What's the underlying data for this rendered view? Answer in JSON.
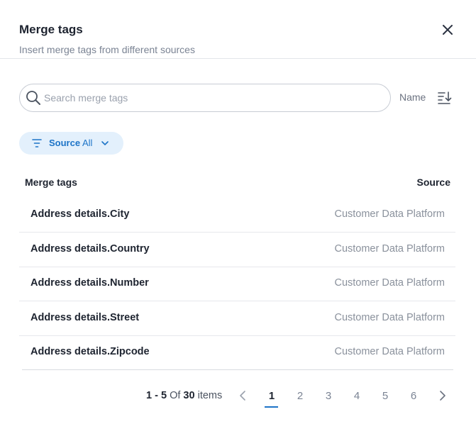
{
  "dialog": {
    "title": "Merge tags",
    "subtitle": "Insert merge tags from different sources",
    "close_icon": "close-icon"
  },
  "search": {
    "placeholder": "Search merge tags",
    "value": "",
    "icon": "search-icon"
  },
  "sort": {
    "label": "Name",
    "icon": "sort-descending-icon"
  },
  "filter": {
    "key": "Source",
    "value": "All",
    "icon": "filter-icon",
    "chevron": "chevron-down-icon"
  },
  "table": {
    "columns": [
      "Merge tags",
      "Source"
    ],
    "rows": [
      {
        "tag": "Address details.City",
        "source": "Customer Data Platform"
      },
      {
        "tag": "Address details.Country",
        "source": "Customer Data Platform"
      },
      {
        "tag": "Address details.Number",
        "source": "Customer Data Platform"
      },
      {
        "tag": "Address details.Street",
        "source": "Customer Data Platform"
      },
      {
        "tag": "Address details.Zipcode",
        "source": "Customer Data Platform"
      }
    ]
  },
  "pagination": {
    "range_start": "1",
    "range_sep": " - ",
    "range_end": "5",
    "of_label": " Of ",
    "total": "30",
    "items_label": " items",
    "pages": [
      "1",
      "2",
      "3",
      "4",
      "5",
      "6"
    ],
    "current_page": "1",
    "prev_icon": "chevron-left-icon",
    "next_icon": "chevron-right-icon"
  },
  "colors": {
    "accent": "#1d74c7",
    "chip_bg": "#e3f0fc",
    "text_primary": "#1e2430",
    "text_muted": "#8a919c"
  }
}
